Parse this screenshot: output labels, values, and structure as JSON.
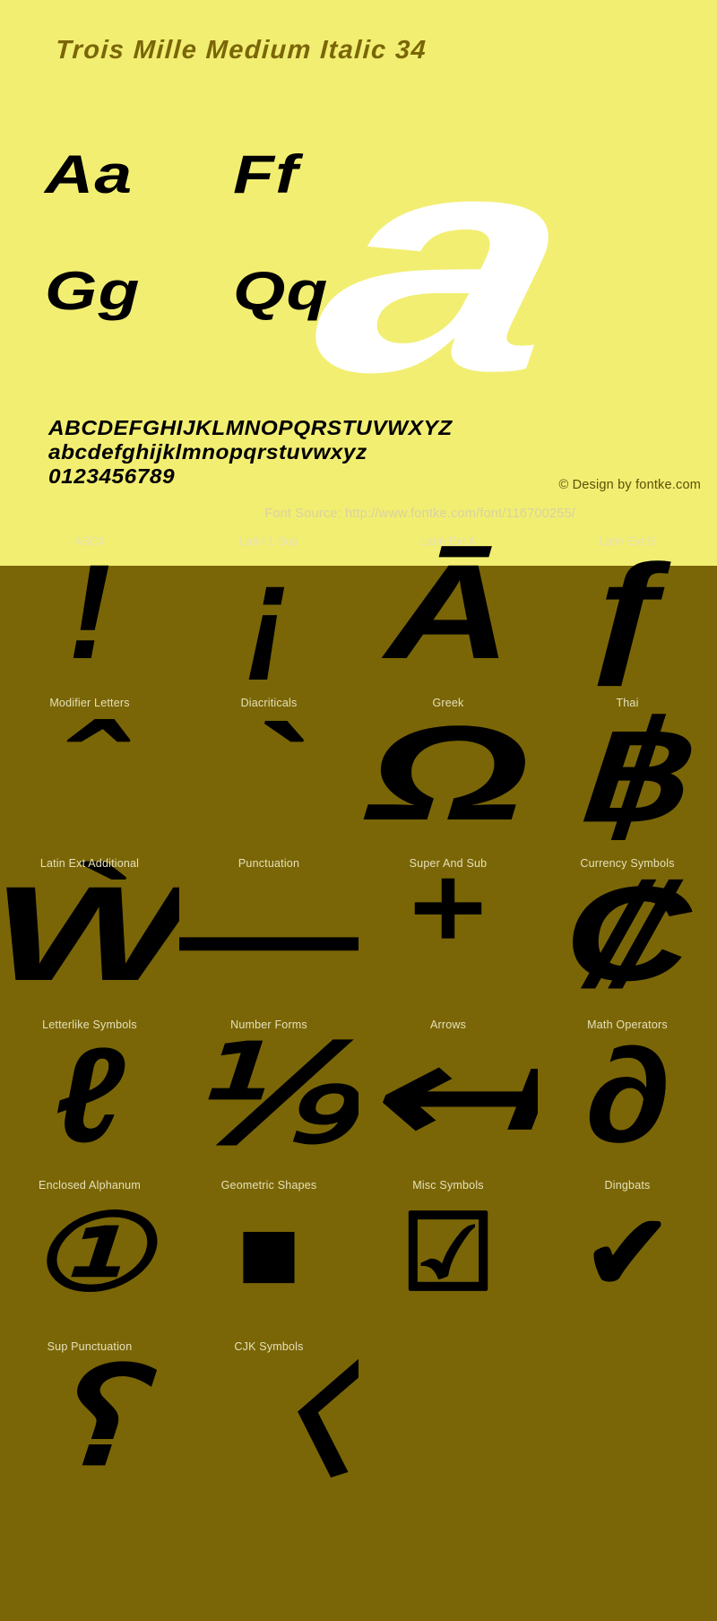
{
  "specimen": {
    "title": "Trois Mille Medium Italic 34",
    "hero_glyph": "a",
    "letter_pairs": [
      [
        "Aa",
        "Ff"
      ],
      [
        "Gg",
        "Qq"
      ]
    ],
    "alphabet_uppercase": "ABCDEFGHIJKLMNOPQRSTUVWXYZ",
    "alphabet_lowercase": "abcdefghijklmnopqrstuvwxyz",
    "digits": "0123456789",
    "credit": "© Design by fontke.com",
    "source": "Font Source: http://www.fontke.com/font/116700255/"
  },
  "colors": {
    "specimen_background": "#f2ee72",
    "blocks_background": "#7a6607",
    "title_text": "#7a6607",
    "glyph_black": "#000000",
    "hero_white": "#ffffff",
    "label_text": "#e6e0b8"
  },
  "unicode_blocks": [
    [
      {
        "label": "ASCII",
        "glyph": "!"
      },
      {
        "label": "Latin 1 Sup",
        "glyph": "¡"
      },
      {
        "label": "Latin Ext A",
        "glyph": "Ā"
      },
      {
        "label": "Latin Ext B",
        "glyph": "ƒ"
      }
    ],
    [
      {
        "label": "Modifier Letters",
        "glyph": "ˆ"
      },
      {
        "label": "Diacriticals",
        "glyph": "`"
      },
      {
        "label": "Greek",
        "glyph": "Ω"
      },
      {
        "label": "Thai",
        "glyph": "฿"
      }
    ],
    [
      {
        "label": "Latin Ext Additional",
        "glyph": "Ẁ"
      },
      {
        "label": "Punctuation",
        "glyph": "—"
      },
      {
        "label": "Super And Sub",
        "glyph": "⁺"
      },
      {
        "label": "Currency Symbols",
        "glyph": "₡"
      }
    ],
    [
      {
        "label": "Letterlike Symbols",
        "glyph": "ℓ"
      },
      {
        "label": "Number Forms",
        "glyph": "⅑"
      },
      {
        "label": "Arrows",
        "glyph": "↤"
      },
      {
        "label": "Math Operators",
        "glyph": "∂"
      }
    ],
    [
      {
        "label": "Enclosed Alphanum",
        "glyph": "①"
      },
      {
        "label": "Geometric Shapes",
        "glyph": "■"
      },
      {
        "label": "Misc Symbols",
        "glyph": "☑"
      },
      {
        "label": "Dingbats",
        "glyph": "✔"
      }
    ],
    [
      {
        "label": "Sup Punctuation",
        "glyph": "⸮"
      },
      {
        "label": "CJK Symbols",
        "glyph": "〈"
      },
      {
        "label": "",
        "glyph": ""
      },
      {
        "label": "",
        "glyph": ""
      }
    ]
  ]
}
